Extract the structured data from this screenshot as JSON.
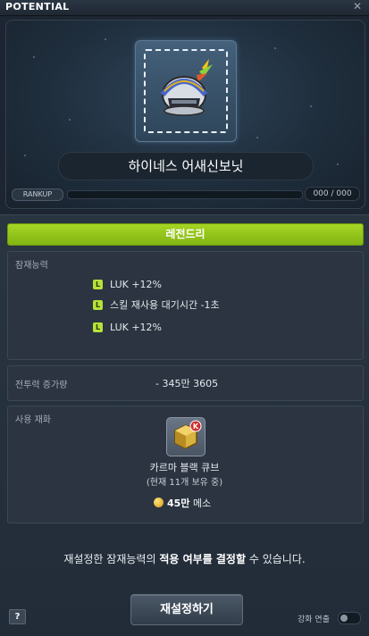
{
  "window": {
    "title": "POTENTIAL",
    "close_glyph": "✕"
  },
  "item": {
    "name": "하이네스 어새신보닛",
    "icon": "helmet-icon"
  },
  "rankup": {
    "label": "RANKUP",
    "value": "000 / 000",
    "progress": 0
  },
  "grade": {
    "label": "레전드리",
    "color": "#a6d624"
  },
  "potential": {
    "label": "잠재능력",
    "badge": "L",
    "lines": [
      {
        "badge": "L",
        "text": "LUK +12%"
      },
      {
        "badge": "L",
        "text": "스킬 재사용 대기시간 -1초"
      },
      {
        "badge": "L",
        "text": "LUK +12%"
      }
    ]
  },
  "power": {
    "label": "전투력 증가량",
    "value": "- 345만 3605"
  },
  "material": {
    "label": "사용 재화",
    "icon": "karma-black-cube-icon",
    "name": "카르마 블랙 큐브",
    "count": "(현재 11개 보유 중)",
    "cost_amount": "45만",
    "cost_unit": "메소"
  },
  "notice": {
    "prefix": "재설정한 잠재능력의",
    "bold": "적용 여부를 결정할",
    "suffix": "수 있습니다."
  },
  "buttons": {
    "reset": "재설정하기",
    "help": "?"
  },
  "toggle": {
    "label": "강화 연출",
    "on": false
  }
}
